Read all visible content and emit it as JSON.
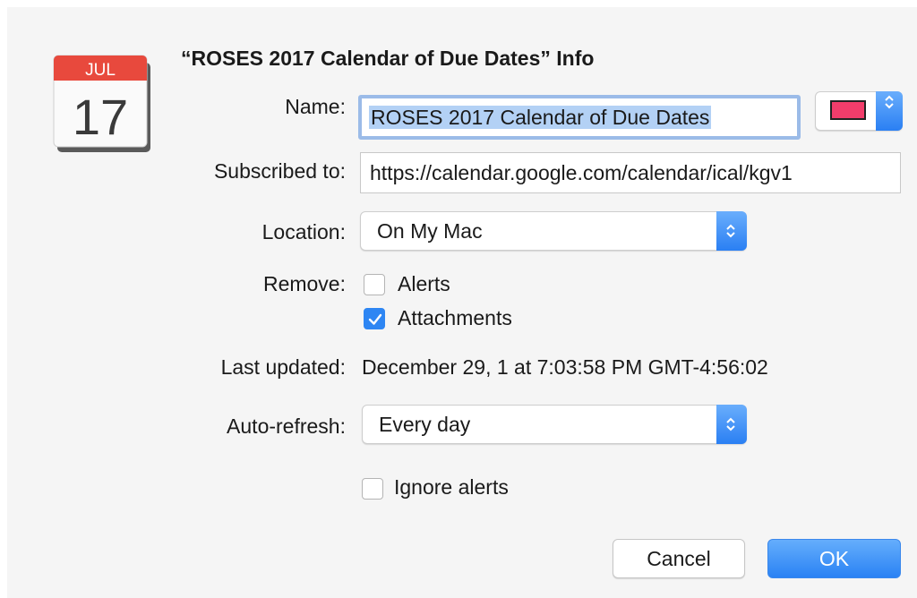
{
  "dialog": {
    "title": "“ROSES 2017 Calendar of Due Dates” Info",
    "app_icon": {
      "icon": "calendar-icon",
      "month": "JUL",
      "day": "17"
    },
    "name": {
      "label": "Name:",
      "value": "ROSES 2017 Calendar of Due Dates"
    },
    "color": {
      "value": "#f23d6b"
    },
    "subscribed": {
      "label": "Subscribed to:",
      "value": "https://calendar.google.com/calendar/ical/kgv1"
    },
    "location": {
      "label": "Location:",
      "value": "On My Mac"
    },
    "remove": {
      "label": "Remove:",
      "options": [
        {
          "label": "Alerts",
          "checked": false
        },
        {
          "label": "Attachments",
          "checked": true
        }
      ]
    },
    "last_updated": {
      "label": "Last updated:",
      "value": "December 29, 1 at 7:03:58 PM GMT-4:56:02"
    },
    "auto_refresh": {
      "label": "Auto-refresh:",
      "value": "Every day"
    },
    "ignore_alerts": {
      "label": "Ignore alerts",
      "checked": false
    },
    "buttons": {
      "cancel": "Cancel",
      "ok": "OK"
    }
  }
}
